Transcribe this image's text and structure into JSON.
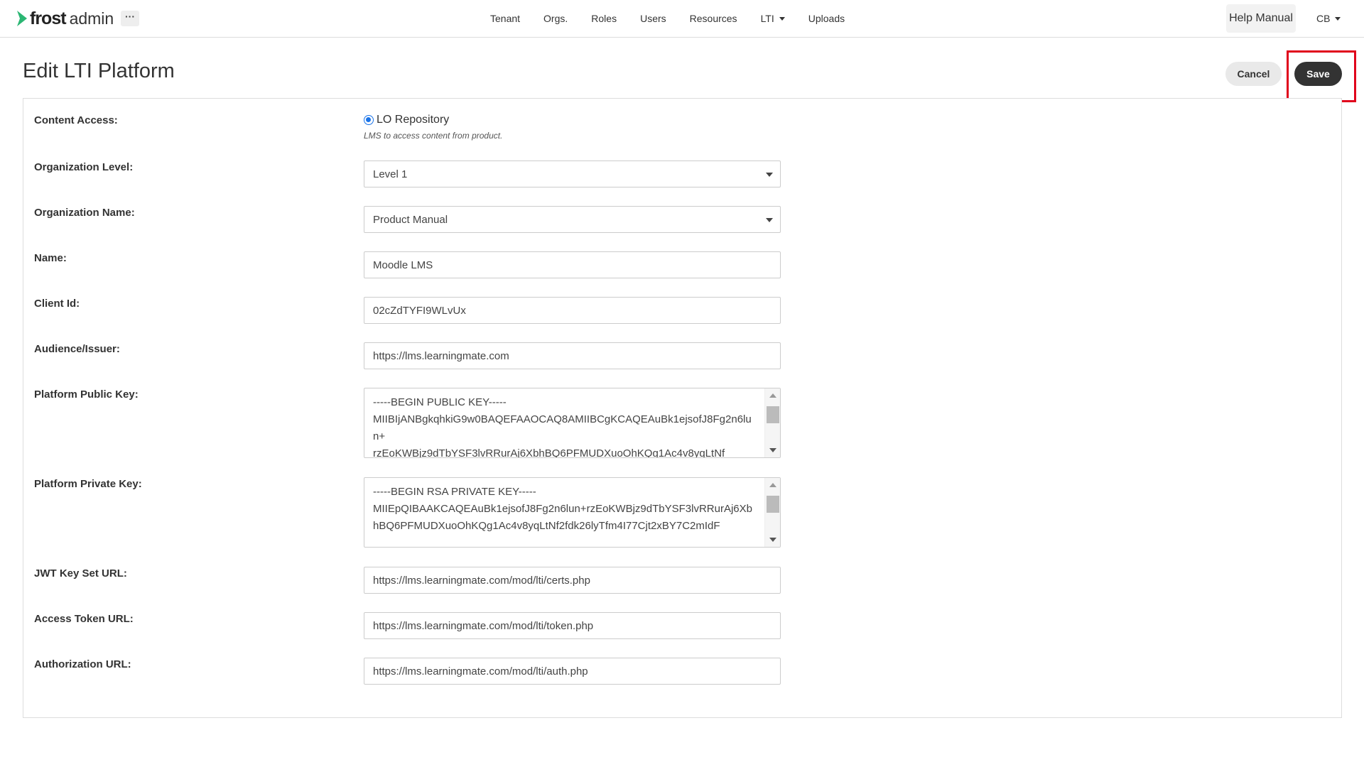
{
  "nav": {
    "logo_primary": "frost",
    "logo_secondary": "admin",
    "more_label": "···",
    "items": [
      {
        "label": "Tenant"
      },
      {
        "label": "Orgs."
      },
      {
        "label": "Roles"
      },
      {
        "label": "Users"
      },
      {
        "label": "Resources"
      },
      {
        "label": "LTI",
        "has_dropdown": true
      },
      {
        "label": "Uploads"
      }
    ],
    "help_label": "Help Manual",
    "user_initials": "CB"
  },
  "page": {
    "title": "Edit LTI Platform",
    "cancel_label": "Cancel",
    "save_label": "Save"
  },
  "form": {
    "content_access": {
      "label": "Content Access:",
      "option": "LO Repository",
      "selected": true,
      "help": "LMS to access content from product."
    },
    "org_level": {
      "label": "Organization Level:",
      "value": "Level 1"
    },
    "org_name": {
      "label": "Organization Name:",
      "value": "Product Manual"
    },
    "name": {
      "label": "Name:",
      "value": "Moodle LMS"
    },
    "client_id": {
      "label": "Client Id:",
      "value": "02cZdTYFI9WLvUx"
    },
    "audience": {
      "label": "Audience/Issuer:",
      "value": "https://lms.learningmate.com"
    },
    "public_key": {
      "label": "Platform Public Key:",
      "value": "-----BEGIN PUBLIC KEY-----\nMIIBIjANBgkqhkiG9w0BAQEFAAOCAQ8AMIIBCgKCAQEAuBk1ejsofJ8Fg2n6lun+\nrzEoKWBjz9dTbYSF3lvRRurAj6XbhBQ6PFMUDXuoOhKQg1Ac4v8yqLtNf"
    },
    "private_key": {
      "label": "Platform Private Key:",
      "value": "-----BEGIN RSA PRIVATE KEY-----\nMIIEpQIBAAKCAQEAuBk1ejsofJ8Fg2n6lun+rzEoKWBjz9dTbYSF3lvRRurAj6Xb\nhBQ6PFMUDXuoOhKQg1Ac4v8yqLtNf2fdk26lyTfm4I77Cjt2xBY7C2mIdF"
    },
    "jwks_url": {
      "label": "JWT Key Set URL:",
      "value": "https://lms.learningmate.com/mod/lti/certs.php"
    },
    "token_url": {
      "label": "Access Token URL:",
      "value": "https://lms.learningmate.com/mod/lti/token.php"
    },
    "auth_url": {
      "label": "Authorization URL:",
      "value": "https://lms.learningmate.com/mod/lti/auth.php"
    }
  },
  "colors": {
    "accent": "#333333",
    "radio": "#1a73e8",
    "highlight": "#e0001b",
    "logo_green": "#2bb673"
  },
  "icons": [
    "frost-logo-icon",
    "more-icon",
    "chevron-down-icon",
    "radio-selected-icon"
  ]
}
